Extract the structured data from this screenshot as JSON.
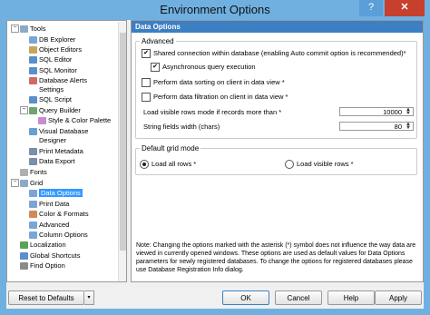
{
  "window": {
    "title": "Environment Options",
    "help_glyph": "?",
    "close_glyph": "✕"
  },
  "tree": {
    "items": [
      {
        "label": "Tools",
        "icon_color": "#8fa8c8",
        "expander": "−"
      },
      {
        "label": "DB Explorer",
        "icon_color": "#7aa6d6"
      },
      {
        "label": "Object Editors",
        "icon_color": "#c9a45b"
      },
      {
        "label": "SQL Editor",
        "icon_color": "#5b8fc9"
      },
      {
        "label": "SQL Monitor",
        "icon_color": "#5b8fc9"
      },
      {
        "label": "Database Alerts",
        "icon_color": "#d06a6a"
      },
      {
        "label": "Settings",
        "icon_color": ""
      },
      {
        "label": "SQL Script",
        "icon_color": "#5b8fc9"
      },
      {
        "label": "Query Builder",
        "icon_color": "#6fa36f",
        "expander": "−"
      },
      {
        "label": "Style & Color Palette",
        "icon_color": "#c88bd0"
      },
      {
        "label": "Visual Database",
        "icon_color": "#6aa0d0"
      },
      {
        "label": "Designer",
        "icon_color": ""
      },
      {
        "label": "Print Metadata",
        "icon_color": "#7a8fa8"
      },
      {
        "label": "Data Export",
        "icon_color": "#7a8fa8"
      },
      {
        "label": "Fonts",
        "icon_color": "#b0b0b0"
      },
      {
        "label": "Grid",
        "icon_color": "#8fa8c8",
        "expander": "−"
      },
      {
        "label": "Data Options",
        "icon_color": "#7aa6d6",
        "selected": true
      },
      {
        "label": "Print Data",
        "icon_color": "#7aa6d6"
      },
      {
        "label": "Color & Formats",
        "icon_color": "#d08a5a"
      },
      {
        "label": "Advanced",
        "icon_color": "#7aa6d6"
      },
      {
        "label": "Column Options",
        "icon_color": "#7aa6d6"
      },
      {
        "label": "Localization",
        "icon_color": "#5ba05b"
      },
      {
        "label": "Global Shortcuts",
        "icon_color": "#5b8fc9"
      },
      {
        "label": "Find Option",
        "icon_color": "#8a8a8a"
      }
    ]
  },
  "panel": {
    "header": "Data Options",
    "advanced": {
      "title": "Advanced",
      "options": [
        {
          "label": "Shared connection within database (enabling Auto commit option is recommended)*",
          "checked": true
        },
        {
          "label": "Asynchronous query execution",
          "checked": true
        },
        {
          "label": "Perform data sorting on client in data view *",
          "checked": false
        },
        {
          "label": "Perform data filtration on client in data view *",
          "checked": false
        }
      ],
      "load_rows_label": "Load visible rows mode if records more than *",
      "load_rows_value": "10000",
      "string_width_label": "String fields width (chars)",
      "string_width_value": "80"
    },
    "default_grid": {
      "title": "Default grid mode",
      "options": [
        {
          "label": "Load all rows *",
          "selected": true
        },
        {
          "label": "Load visible rows *",
          "selected": false
        }
      ]
    },
    "note": "Note: Changing the options marked with the asterisk (*) symbol does not influence the way data are viewed in currently opened windows. These options are used as default values for Data Options parameters for newly registered databases. To change the options for registered databases please use Database Registration Info dialog."
  },
  "buttons": {
    "reset": "Reset to Defaults",
    "reset_dropdown": "▾",
    "ok": "OK",
    "cancel": "Cancel",
    "help": "Help",
    "apply": "Apply"
  },
  "spin_arrows": {
    "up": "▲",
    "down": "▼"
  },
  "checkmark": "✔"
}
